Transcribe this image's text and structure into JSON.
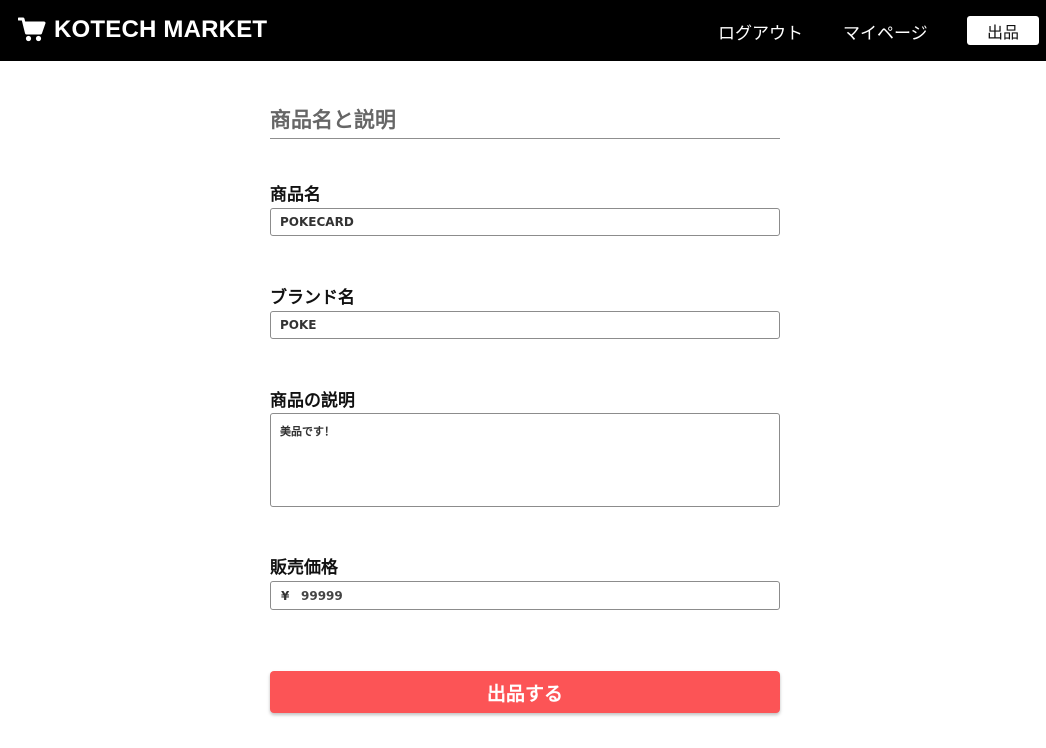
{
  "header": {
    "brand": "KOTECH MARKET",
    "brand_icon": "shopping-cart-icon",
    "nav": {
      "logout": "ログアウト",
      "mypage": "マイページ",
      "sell": "出品"
    }
  },
  "form": {
    "section_title": "商品名と説明",
    "name": {
      "label": "商品名",
      "value": "POKECARD"
    },
    "brand": {
      "label": "ブランド名",
      "value": "POKE"
    },
    "description": {
      "label": "商品の説明",
      "value": "美品です！"
    },
    "price": {
      "label": "販売価格",
      "currency": "¥",
      "value": "99999"
    },
    "submit": "出品する"
  },
  "colors": {
    "header_bg": "#000000",
    "accent": "#fc5456",
    "section_title": "#666666"
  }
}
